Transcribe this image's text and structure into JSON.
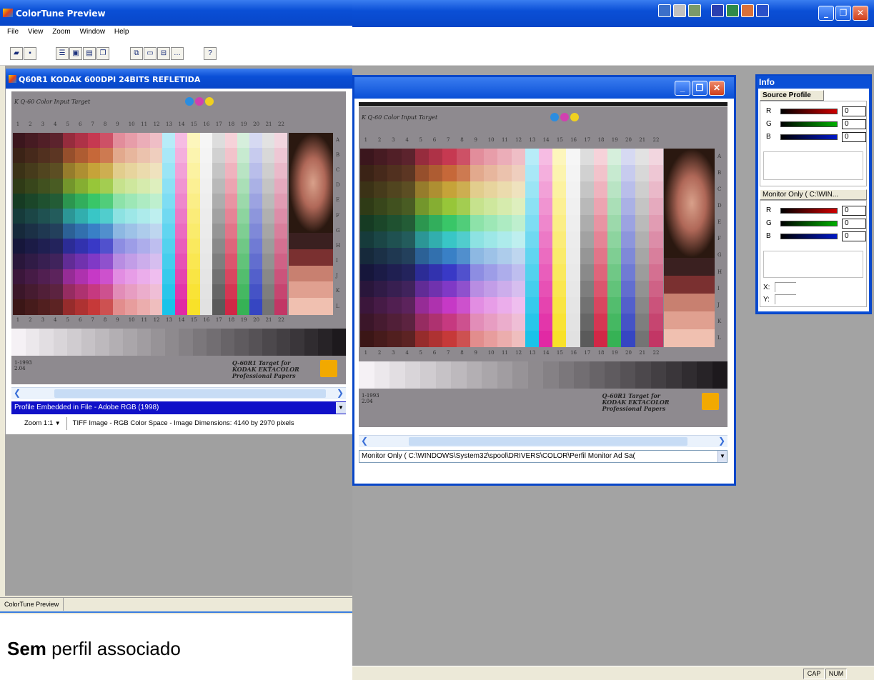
{
  "main_window": {
    "title": "ColorTune Preview",
    "menu": [
      "File",
      "View",
      "Zoom",
      "Window",
      "Help"
    ],
    "status_bar": "ColorTune Preview"
  },
  "left_doc": {
    "title": "Q60R1 KODAK 600DPI 24BITS REFLETIDA",
    "target_label": "K Q-60 Color Input Target",
    "row_numbers": [
      "1",
      "2",
      "3",
      "4",
      "5",
      "6",
      "7",
      "8",
      "9",
      "10",
      "11",
      "12",
      "13",
      "14",
      "15",
      "16",
      "17",
      "18",
      "19",
      "20",
      "21",
      "22"
    ],
    "row_letters": [
      "A",
      "B",
      "C",
      "D",
      "E",
      "F",
      "G",
      "H",
      "I",
      "J",
      "K",
      "L"
    ],
    "date_text": "1-1993\n2.04",
    "kodak_text": "Q-60R1 Target for\nKODAK EKTACOLOR\nProfessional Papers",
    "profile_combo": "Profile Embedded in File - Adobe RGB (1998)",
    "zoom_label": "Zoom 1:1",
    "image_info": "TIFF Image - RGB Color Space - Image Dimensions: 4140 by 2970 pixels"
  },
  "right_doc": {
    "target_label": "K Q-60 Color Input Target",
    "date_text": "1-1993\n2.04",
    "kodak_text": "Q-60R1 Target for\nKODAK EKTACOLOR\nProfessional Papers",
    "profile_combo": "Monitor Only ( C:\\WINDOWS\\System32\\spool\\DRIVERS\\COLOR\\Perfil Monitor Ad Sa("
  },
  "info_panel": {
    "title": "Info",
    "source_profile_tab": "Source Profile",
    "monitor_tab": "Monitor Only ( C:\\WIN...",
    "channels": [
      "R",
      "G",
      "B"
    ],
    "source_values": [
      "0",
      "0",
      "0"
    ],
    "monitor_values": [
      "0",
      "0",
      "0"
    ],
    "x_label": "X:",
    "y_label": "Y:"
  },
  "status_right": [
    "CAP",
    "NUM"
  ],
  "caption": {
    "bold": "Sem",
    "rest": " perfil associado"
  },
  "colors": {
    "xp_blue": "#0a4fd6",
    "profile_bar": "#1010c8",
    "workspace_gray": "#a0a0a0"
  }
}
